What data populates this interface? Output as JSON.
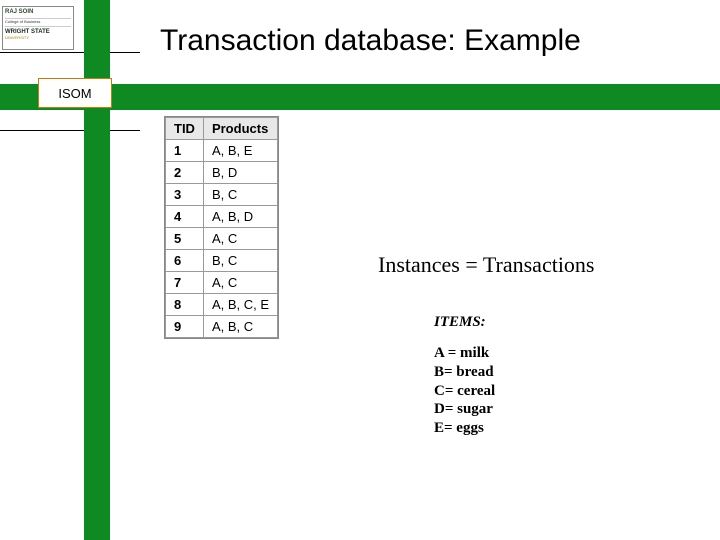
{
  "title": "Transaction database: Example",
  "isom_label": "ISOM",
  "logo": {
    "line1": "RAJ SOIN",
    "line2": "College of Business",
    "line3": "WRIGHT STATE",
    "line4": "UNIVERSITY"
  },
  "table": {
    "headers": {
      "tid": "TID",
      "products": "Products"
    },
    "rows": [
      {
        "tid": "1",
        "products": "A, B, E"
      },
      {
        "tid": "2",
        "products": "B, D"
      },
      {
        "tid": "3",
        "products": "B, C"
      },
      {
        "tid": "4",
        "products": "A, B, D"
      },
      {
        "tid": "5",
        "products": "A, C"
      },
      {
        "tid": "6",
        "products": "B, C"
      },
      {
        "tid": "7",
        "products": "A, C"
      },
      {
        "tid": "8",
        "products": "A, B, C, E"
      },
      {
        "tid": "9",
        "products": "A, B, C"
      }
    ]
  },
  "instances_label": "Instances = Transactions",
  "items": {
    "heading": "ITEMS:",
    "list": [
      "A = milk",
      "B= bread",
      "C= cereal",
      "D= sugar",
      "E= eggs"
    ]
  }
}
